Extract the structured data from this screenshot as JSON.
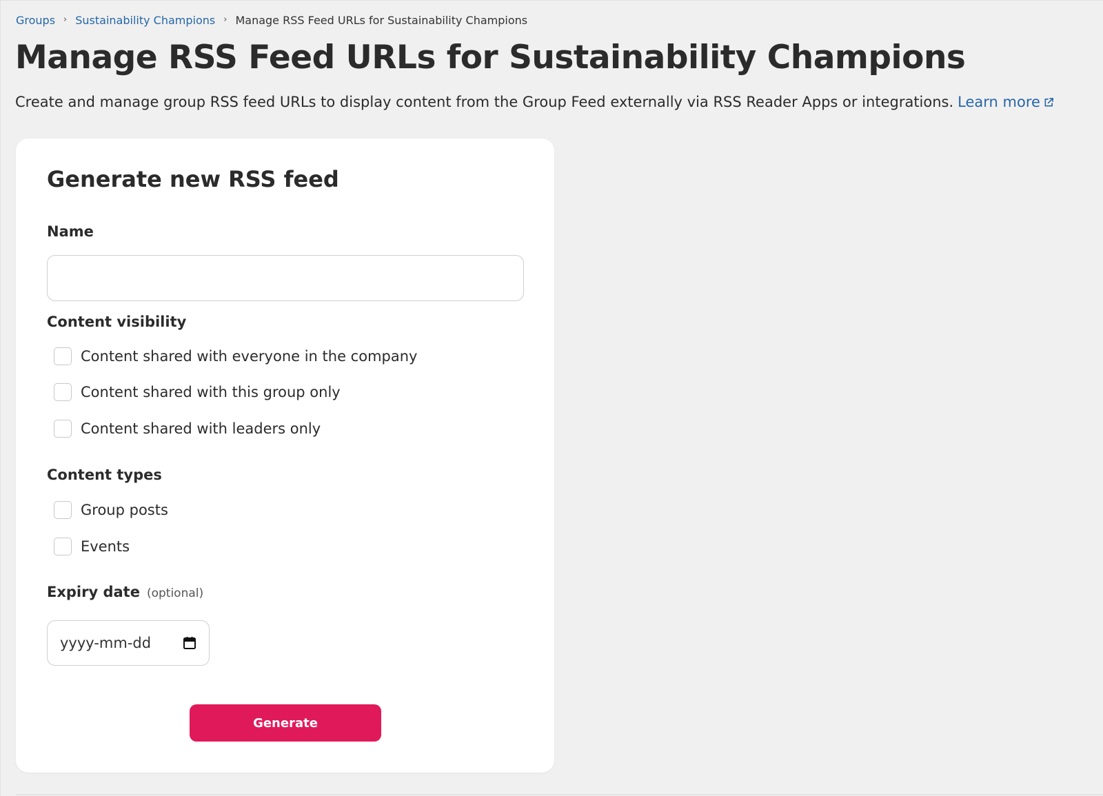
{
  "breadcrumb": {
    "items": [
      "Groups",
      "Sustainability Champions"
    ],
    "separator": "›",
    "current": "Manage RSS Feed URLs for Sustainability Champions"
  },
  "page": {
    "title": "Manage RSS Feed URLs for Sustainability Champions",
    "description": "Create and manage group RSS feed URLs to display content from the Group Feed externally via RSS Reader Apps or integrations.",
    "learn_more": "Learn more"
  },
  "form": {
    "title": "Generate new RSS feed",
    "name_label": "Name",
    "name_value": "",
    "visibility_label": "Content visibility",
    "visibility_options": [
      "Content shared with everyone in the company",
      "Content shared with this group only",
      "Content shared with leaders only"
    ],
    "types_label": "Content types",
    "type_options": [
      "Group posts",
      "Events"
    ],
    "expiry_label": "Expiry date",
    "expiry_optional": "(optional)",
    "expiry_placeholder": "yyyy-mm-dd",
    "generate_label": "Generate"
  },
  "colors": {
    "link": "#2567a8",
    "primary_button": "#e0195a",
    "background": "#f0f0f0",
    "card": "#ffffff",
    "text": "#2b2b2b"
  },
  "icons": {
    "breadcrumb_separator": "chevron-right-icon",
    "learn_more": "external-link-icon",
    "date_picker": "calendar-icon"
  }
}
